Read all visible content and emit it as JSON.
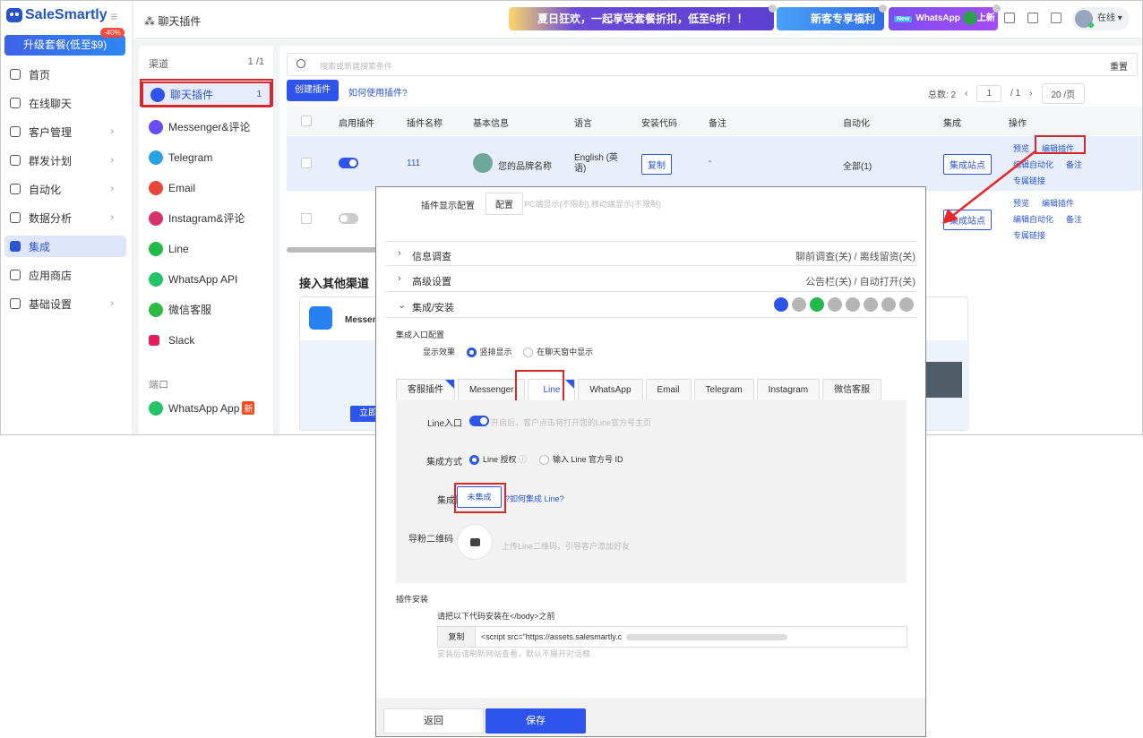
{
  "brand": {
    "name": "SaleSmartly",
    "upgrade": "升级套餐(低至$9)",
    "discount": "-40%"
  },
  "nav": [
    {
      "label": "首页",
      "chev": ""
    },
    {
      "label": "在线聊天",
      "chev": ""
    },
    {
      "label": "客户管理",
      "chev": "›"
    },
    {
      "label": "群发计划",
      "chev": "›"
    },
    {
      "label": "自动化",
      "chev": "›"
    },
    {
      "label": "数据分析",
      "chev": "›"
    },
    {
      "label": "集成",
      "chev": ""
    },
    {
      "label": "应用商店",
      "chev": ""
    },
    {
      "label": "基础设置",
      "chev": "›"
    }
  ],
  "topbar": {
    "crumb": "聊天插件",
    "promo1": "夏日狂欢，一起享受套餐折扣，低至6折！！",
    "promo2": "新客专享福利",
    "promo3_new": "New",
    "promo3": "WhatsApp",
    "promo3_tail": "上新",
    "status": "在线"
  },
  "channels": {
    "title": "渠道",
    "count": "1 /1",
    "items": [
      {
        "label": "聊天插件",
        "count": "1",
        "color": "#2f54eb"
      },
      {
        "label": "Messenger&评论",
        "count": "",
        "color": "#6a4df2"
      },
      {
        "label": "Telegram",
        "count": "",
        "color": "#2aa3e0"
      },
      {
        "label": "Email",
        "count": "",
        "color": "#e8453c"
      },
      {
        "label": "Instagram&评论",
        "count": "",
        "color": "#d6336c"
      },
      {
        "label": "Line",
        "count": "",
        "color": "#22b84a"
      },
      {
        "label": "WhatsApp API",
        "count": "",
        "color": "#25c26a"
      },
      {
        "label": "微信客服",
        "count": "",
        "color": "#2fba43"
      },
      {
        "label": "Slack",
        "count": "",
        "color": "#e01e5a"
      }
    ],
    "section2": "端口",
    "item_app": "WhatsApp App",
    "item_app_badge": "新"
  },
  "main": {
    "search_placeholder": "搜索或新建搜索条件",
    "reset": "重置",
    "create": "创建插件",
    "howto": "如何使用插件?",
    "total": "总数: 2",
    "page": "1",
    "pages": "/  1",
    "per_page": "20 /页",
    "prev": "‹",
    "next": "›",
    "cols": [
      "启用插件",
      "插件名称",
      "基本信息",
      "语言",
      "安装代码",
      "备注",
      "自动化",
      "集成",
      "操作"
    ],
    "row1": {
      "name": "111",
      "info": "您的品牌名称",
      "lang": "English (英语)",
      "install": "复制",
      "note": "-",
      "auto": "全部(1)",
      "integ": "集成站点"
    },
    "row2": {
      "integ": "集成站点"
    },
    "ops": {
      "preview": "预览",
      "edit": "编辑插件",
      "edit_auto": "编辑自动化",
      "note": "备注",
      "link": "专属链接"
    },
    "other_title": "接入其他渠道",
    "card_title": "Messen",
    "card_cta": "立即"
  },
  "overlay": {
    "display_label": "插件显示配置",
    "display_btn": "配置",
    "display_hint": "PC端显示(不限制),移动端显示(不限制)",
    "sec1": "信息调查",
    "sec1_r": "聊前调查(关) / 离线留资(关)",
    "sec2": "高级设置",
    "sec2_r": "公告栏(关) / 自动打开(关)",
    "sec3": "集成/安装",
    "entry_cfg": "集成入口配置",
    "effect_label": "显示效果",
    "effect_opt1": "竖排显示",
    "effect_opt2": "在聊天窗中显示",
    "tabs": [
      "客服插件",
      "Messenger",
      "Line",
      "WhatsApp",
      "Email",
      "Telegram",
      "Instagram",
      "微信客服"
    ],
    "line_entry": "Line入口",
    "line_entry_hint": "开启后，客户点击将打开您的Line官方号主页",
    "method_label": "集成方式",
    "method_opt1": "Line 授权",
    "method_opt2": "输入 Line 官方号 ID",
    "account_label": "集成账号",
    "account_btn": "未集成",
    "account_help": "如何集成 Line?",
    "qr_label": "导粉二维码",
    "qr_hint": "上传Line二维码，引导客户添加好友",
    "install_title": "插件安装",
    "install_desc": "请把以下代码安装在</body>之前",
    "copy": "复制",
    "code": "<script src=\"https://assets.salesmartly.c",
    "install_hint": "安装后请刷新网站查看，默认不展开对话框",
    "back": "返回",
    "save": "保存"
  }
}
